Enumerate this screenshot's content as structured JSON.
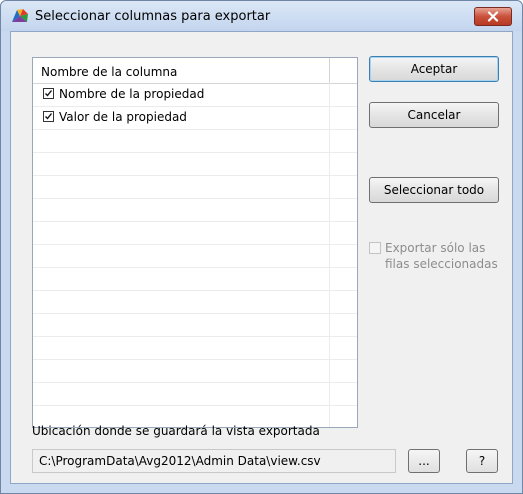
{
  "window": {
    "title": "Seleccionar columnas para exportar",
    "icon": "avg-app-icon",
    "close_icon": "close-icon"
  },
  "columns_list": {
    "header": "Nombre de la columna",
    "rows": [
      {
        "label": "Nombre de la propiedad",
        "checked": true
      },
      {
        "label": "Valor de la propiedad",
        "checked": true
      }
    ]
  },
  "buttons": {
    "accept": "Aceptar",
    "cancel": "Cancelar",
    "select_all": "Seleccionar todo"
  },
  "export_option": {
    "label": "Exportar sólo las filas seleccionadas",
    "checked": false,
    "enabled": false
  },
  "location": {
    "label": "Ubicación donde se guardará la vista exportada",
    "path": "C:\\ProgramData\\Avg2012\\Admin Data\\view.csv",
    "browse_label": "...",
    "help_label": "?"
  },
  "colors": {
    "accent": "#3c7fb1",
    "close": "#c9513c"
  }
}
